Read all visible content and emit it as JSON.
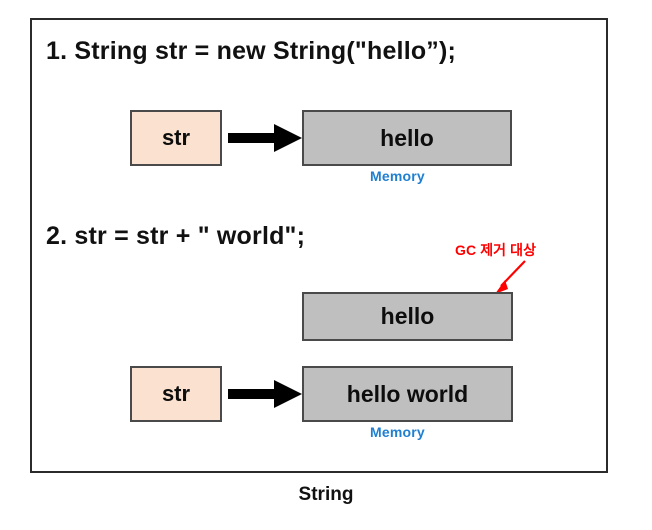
{
  "diagram": {
    "caption": "String",
    "statements": [
      {
        "id": "stmt-1",
        "text": "1. String str = new String(\"hello”);"
      },
      {
        "id": "stmt-2",
        "text": "2. str = str + \" world\";"
      }
    ],
    "step1": {
      "variable_box_label": "str",
      "memory_box_label": "hello",
      "memory_caption": "Memory",
      "arrow": "points-right-arrow"
    },
    "step2": {
      "orphan_box_label": "hello",
      "variable_box_label": "str",
      "memory_box_label": "hello world",
      "memory_caption": "Memory",
      "arrow": "points-right-arrow",
      "gc_annotation": "GC 제거 대상",
      "gc_arrow": "red-diagonal-arrow"
    }
  },
  "colors": {
    "variable_box_fill": "#FBE2D0",
    "memory_box_fill": "#BFBFBF",
    "box_border": "#4A4A4A",
    "frame_border": "#2B2B2B",
    "memory_label": "#1F7FD1",
    "gc_annotation": "#FF0000",
    "text": "#111111",
    "background": "#FFFFFF"
  }
}
